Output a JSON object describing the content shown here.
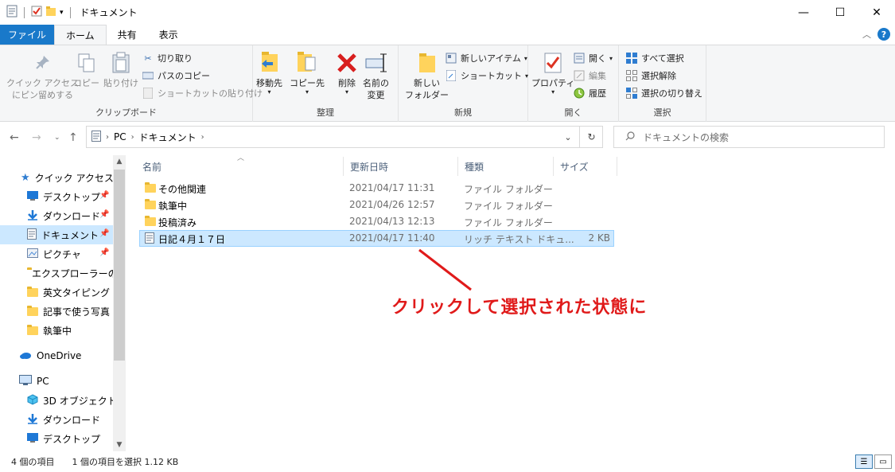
{
  "window": {
    "title": "ドキュメント",
    "controls": {
      "minimize": "—",
      "maximize": "☐",
      "close": "✕"
    }
  },
  "tabs": [
    {
      "label": "ファイル"
    },
    {
      "label": "ホーム"
    },
    {
      "label": "共有"
    },
    {
      "label": "表示"
    }
  ],
  "ribbon": {
    "clipboard": {
      "label": "クリップボード",
      "pin_label_1": "クイック アクセス",
      "pin_label_2": "にピン留めする",
      "copy": "コピー",
      "paste": "貼り付け",
      "cut": "切り取り",
      "copy_path": "パスのコピー",
      "paste_shortcut": "ショートカットの貼り付け"
    },
    "organize": {
      "label": "整理",
      "move_to": "移動先",
      "copy_to": "コピー先",
      "delete": "削除",
      "rename_1": "名前の",
      "rename_2": "変更"
    },
    "new": {
      "label": "新規",
      "new_folder_1": "新しい",
      "new_folder_2": "フォルダー",
      "new_item": "新しいアイテム",
      "shortcut": "ショートカット"
    },
    "open": {
      "label": "開く",
      "properties": "プロパティ",
      "open": "開く",
      "edit": "編集",
      "history": "履歴"
    },
    "select": {
      "label": "選択",
      "select_all": "すべて選択",
      "select_none": "選択解除",
      "invert": "選択の切り替え"
    }
  },
  "address": {
    "crumbs": [
      "PC",
      "ドキュメント"
    ],
    "search_placeholder": "ドキュメントの検索"
  },
  "navpane": {
    "quick_access": "クイック アクセス",
    "items": [
      {
        "label": "デスクトップ",
        "pinned": true
      },
      {
        "label": "ダウンロード",
        "pinned": true
      },
      {
        "label": "ドキュメント",
        "pinned": true
      },
      {
        "label": "ピクチャ",
        "pinned": true
      },
      {
        "label": "エクスプローラーの使",
        "pinned": false
      },
      {
        "label": "英文タイピング",
        "pinned": false
      },
      {
        "label": "記事で使う写真",
        "pinned": false
      },
      {
        "label": "執筆中",
        "pinned": false
      }
    ],
    "onedrive": "OneDrive",
    "pc": "PC",
    "pc_items": [
      {
        "label": "3D オブジェクト"
      },
      {
        "label": "ダウンロード"
      },
      {
        "label": "デスクトップ"
      }
    ]
  },
  "columns": {
    "name": "名前",
    "date": "更新日時",
    "type": "種類",
    "size": "サイズ"
  },
  "files": [
    {
      "name": "その他関連",
      "date": "2021/04/17 11:31",
      "type": "ファイル フォルダー",
      "size": ""
    },
    {
      "name": "執筆中",
      "date": "2021/04/26 12:57",
      "type": "ファイル フォルダー",
      "size": ""
    },
    {
      "name": "投稿済み",
      "date": "2021/04/13 12:13",
      "type": "ファイル フォルダー",
      "size": ""
    },
    {
      "name": "日記４月１７日",
      "date": "2021/04/17 11:40",
      "type": "リッチ テキスト ドキュ...",
      "size": "2 KB"
    }
  ],
  "annotation": "クリックして選択された状態に",
  "status": {
    "count": "4 個の項目",
    "selected": "1 個の項目を選択  1.12 KB"
  },
  "colors": {
    "accent": "#1979ca",
    "selection": "#cce8ff",
    "annotation": "#e01a1a"
  }
}
